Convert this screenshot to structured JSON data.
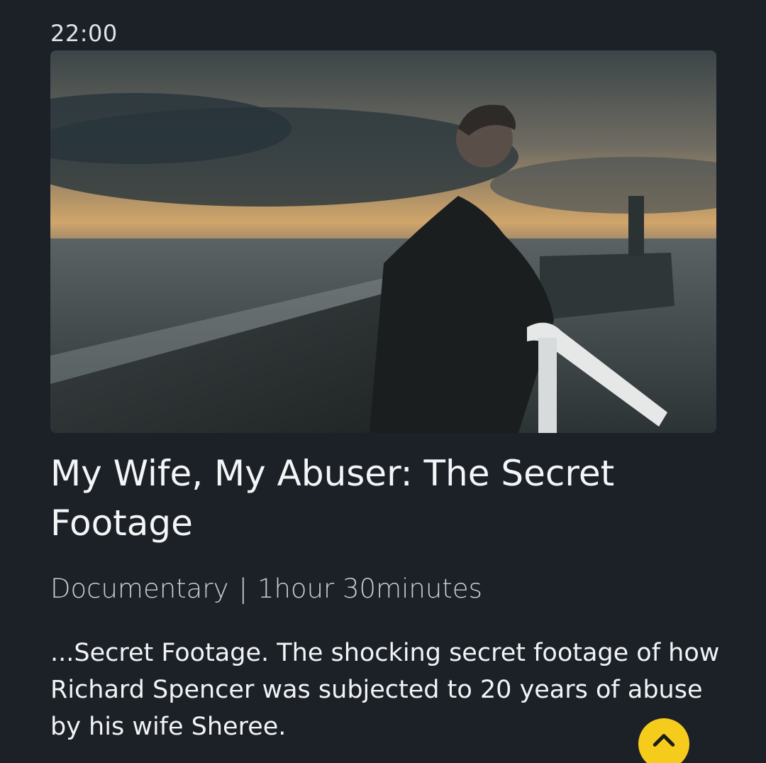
{
  "status_bar": {
    "time": "22:00"
  },
  "programme": {
    "title": "My Wife, My Abuser: The Secret Footage",
    "genre": "Documentary",
    "separator": "|",
    "duration": "1hour 30minutes",
    "description": "...Secret Footage. The shocking secret footage of how Richard Spencer was subjected to 20 years of abuse by his wife Sheree."
  },
  "scroll_up_button": {
    "icon": "chevron-up-icon",
    "color": "#f6cc1c"
  },
  "colors": {
    "background": "#1c2128",
    "accent": "#f6cc1c"
  }
}
